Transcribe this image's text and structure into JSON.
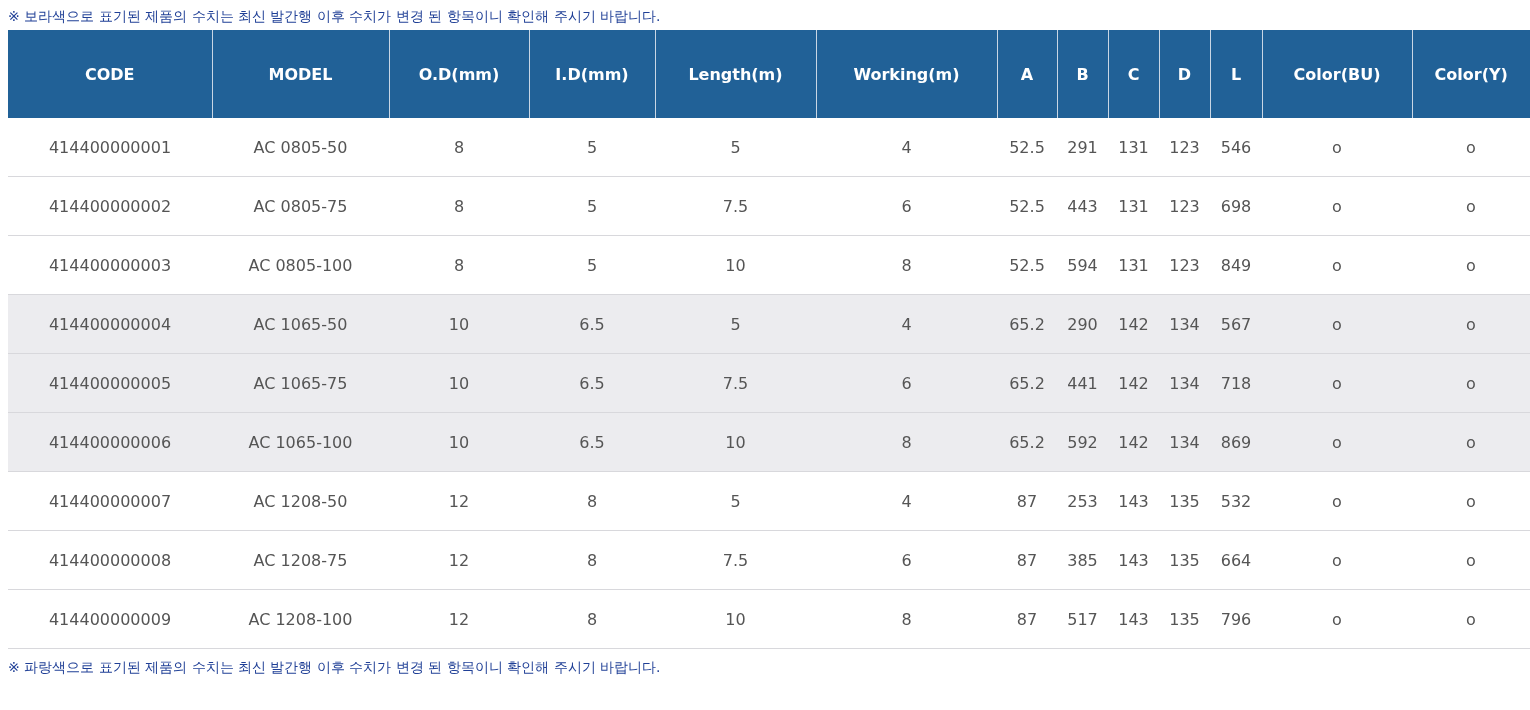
{
  "notes_top": "※ 보라색으로 표기된 제품의 수치는 최신 발간행 이후 수치가 변경 된 항목이니 확인해 주시기 바랍니다.",
  "table": {
    "columns": [
      "CODE",
      "MODEL",
      "O.D(mm)",
      "I.D(mm)",
      "Length(m)",
      "Working(m)",
      "A",
      "B",
      "C",
      "D",
      "L",
      "Color(BU)",
      "Color(Y)"
    ],
    "rows": [
      {
        "highlighted": false,
        "cells": [
          "414400000001",
          "AC 0805-50",
          "8",
          "5",
          "5",
          "4",
          "52.5",
          "291",
          "131",
          "123",
          "546",
          "o",
          "o"
        ]
      },
      {
        "highlighted": false,
        "cells": [
          "414400000002",
          "AC 0805-75",
          "8",
          "5",
          "7.5",
          "6",
          "52.5",
          "443",
          "131",
          "123",
          "698",
          "o",
          "o"
        ]
      },
      {
        "highlighted": false,
        "cells": [
          "414400000003",
          "AC 0805-100",
          "8",
          "5",
          "10",
          "8",
          "52.5",
          "594",
          "131",
          "123",
          "849",
          "o",
          "o"
        ]
      },
      {
        "highlighted": true,
        "cells": [
          "414400000004",
          "AC 1065-50",
          "10",
          "6.5",
          "5",
          "4",
          "65.2",
          "290",
          "142",
          "134",
          "567",
          "o",
          "o"
        ]
      },
      {
        "highlighted": true,
        "cells": [
          "414400000005",
          "AC 1065-75",
          "10",
          "6.5",
          "7.5",
          "6",
          "65.2",
          "441",
          "142",
          "134",
          "718",
          "o",
          "o"
        ]
      },
      {
        "highlighted": true,
        "cells": [
          "414400000006",
          "AC 1065-100",
          "10",
          "6.5",
          "10",
          "8",
          "65.2",
          "592",
          "142",
          "134",
          "869",
          "o",
          "o"
        ]
      },
      {
        "highlighted": false,
        "cells": [
          "414400000007",
          "AC 1208-50",
          "12",
          "8",
          "5",
          "4",
          "87",
          "253",
          "143",
          "135",
          "532",
          "o",
          "o"
        ]
      },
      {
        "highlighted": false,
        "cells": [
          "414400000008",
          "AC 1208-75",
          "12",
          "8",
          "7.5",
          "6",
          "87",
          "385",
          "143",
          "135",
          "664",
          "o",
          "o"
        ]
      },
      {
        "highlighted": false,
        "cells": [
          "414400000009",
          "AC 1208-100",
          "12",
          "8",
          "10",
          "8",
          "87",
          "517",
          "143",
          "135",
          "796",
          "o",
          "o"
        ]
      }
    ]
  },
  "notes_bottom": "※ 파랑색으로 표기된 제품의 수치는 최신 발간행 이후 수치가 변경 된 항목이니 확인해 주시기 바랍니다."
}
